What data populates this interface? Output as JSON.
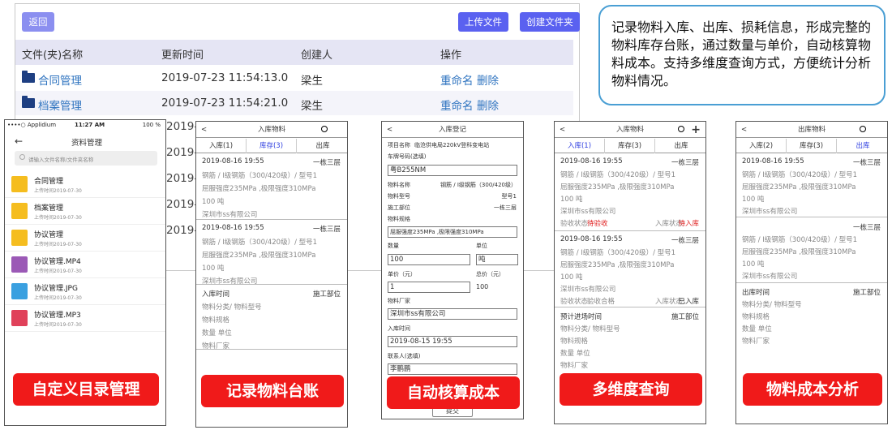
{
  "file_panel": {
    "back": "返回",
    "upload": "上传文件",
    "new_folder": "创建文件夹",
    "headers": [
      "文件(夹)名称",
      "更新时间",
      "创建人",
      "操作"
    ],
    "rows": [
      {
        "name": "合同管理",
        "time": "2019-07-23 11:54:13.0",
        "creator": "梁生",
        "rename": "重命名",
        "delete": "删除"
      },
      {
        "name": "档案管理",
        "time": "2019-07-23 11:54:21.0",
        "creator": "梁生",
        "rename": "重命名",
        "delete": "删除"
      }
    ],
    "partial_dates": [
      "2019-0",
      "2019-0",
      "2019-0",
      "2019-0",
      "2019-0"
    ]
  },
  "info_box": "记录物料入库、出库、损耗信息，形成完整的物料库存台账，通过数量与单价，自动核算物料成本。支持多维度查询方式，方便统计分析物料情况。",
  "phone1": {
    "status_left": "••••○ Applidium",
    "time": "11:27 AM",
    "battery": "100 %",
    "title": "资料管理",
    "back_arrow": "←",
    "search_placeholder": "请输入文件名称/文件夹名称",
    "items": [
      {
        "name": "合同管理",
        "sub": "上传时间2019-07-30",
        "icon": "folder-icon",
        "color": "#f5bd1f"
      },
      {
        "name": "档案管理",
        "sub": "上传时间2019-07-30",
        "icon": "folder-icon",
        "color": "#f5bd1f"
      },
      {
        "name": "协议管理",
        "sub": "上传时间2019-07-30",
        "icon": "folder-icon",
        "color": "#f5bd1f"
      },
      {
        "name": "协议管理.MP4",
        "sub": "上传时间2019-07-30",
        "icon": "video-file-icon",
        "color": "#9b59b6"
      },
      {
        "name": "协议管理.JPG",
        "sub": "上传时间2019-07-30",
        "icon": "image-file-icon",
        "color": "#3aa0e0"
      },
      {
        "name": "协议管理.MP3",
        "sub": "上传时间2019-07-30",
        "icon": "audio-file-icon",
        "color": "#e0415a"
      }
    ],
    "badge": "自定义目录管理"
  },
  "phone2": {
    "back": "<",
    "title": "入库物料",
    "tabs": [
      "入库(1)",
      "库存(3)",
      "出库"
    ],
    "records": [
      {
        "date": "2019-08-16 19:55",
        "loc": "一栋三层",
        "l1": "钢筋 / Ⅰ级钢筋（300/420级）/ 型号1",
        "l2": "屈服强度235MPa ,极限强度310MPa",
        "l3": "100 吨",
        "l4": "深圳市ss有限公司"
      },
      {
        "date": "2019-08-16 19:55",
        "loc": "一栋三层",
        "l1": "钢筋 / Ⅰ级钢筋（300/420级）/ 型号1",
        "l2": "屈服强度235MPa ,极限强度310MPa",
        "l3": "100 吨",
        "l4": "深圳市ss有限公司"
      }
    ],
    "blank": {
      "l0": "入库时间",
      "loc": "施工部位",
      "l1": "物料分类/ 物料型号",
      "l2": "物料规格",
      "l3": "数量 单位",
      "l4": "物料厂家"
    },
    "badge": "记录物料台账"
  },
  "phone3": {
    "back": "<",
    "title": "入库登记",
    "project_label": "项目名称",
    "project_value": "临沧供电局220kV登科变电站",
    "plate_label": "车牌号码(选填)",
    "plate_value": "粤B255NM",
    "name_label": "物料名称",
    "name_value": "钢筋 / Ⅰ级钢筋（300/420级）",
    "model_label": "物料型号",
    "model_value": "型号1",
    "site_label": "施工部位",
    "site_value": "一栋三层",
    "spec_label": "物料规格",
    "spec_value": "屈服强度235MPa ,极限强度310MPa",
    "qty_label": "数量",
    "qty_value": "100",
    "unit_label": "单位",
    "unit_value": "吨",
    "price_label": "单价（元）",
    "price_value": "1",
    "total_label": "总价（元）",
    "total_value": "100",
    "maker_label": "物料厂家",
    "maker_value": "深圳市ss有限公司",
    "time_label": "入库时间",
    "time_value": "2019-08-15 19:55",
    "contact_label": "联系人(选填)",
    "contact_value": "李鹏鹏",
    "submit": "提交",
    "badge": "自动核算成本"
  },
  "phone4": {
    "back": "<",
    "title": "入库物料",
    "tabs": [
      "入库(1)",
      "库存(3)",
      "出库"
    ],
    "records": [
      {
        "date": "2019-08-16 19:55",
        "loc": "一栋三层",
        "l1": "钢筋 / Ⅰ级钢筋（300/420级）/ 型号1",
        "l2": "屈服强度235MPa ,极限强度310MPa",
        "l3": "100 吨",
        "l4": "深圳市ss有限公司",
        "check_label": "验收状态:",
        "check_value": "待验收",
        "in_label": "入库状态:",
        "in_value": "待入库"
      },
      {
        "date": "2019-08-16 19:55",
        "loc": "一栋三层",
        "l1": "钢筋 / Ⅰ级钢筋（300/420级）/ 型号1",
        "l2": "屈服强度235MPa ,极限强度310MPa",
        "l3": "100 吨",
        "l4": "深圳市ss有限公司",
        "check_label": "验收状态:",
        "check_value": "验收合格",
        "in_label": "入库状态:",
        "in_value": "已入库"
      }
    ],
    "blank": {
      "l0": "预计进场时间",
      "loc": "施工部位",
      "l1": "物料分类/ 物料型号",
      "l2": "物料规格",
      "l3": "数量 单位",
      "l4": "物料厂家"
    },
    "badge": "多维度查询"
  },
  "phone5": {
    "back": "<",
    "title": "出库物料",
    "tabs": [
      "入库(2)",
      "库存(3)",
      "出库"
    ],
    "records": [
      {
        "date": "2019-08-16 19:55",
        "loc": "一栋三层",
        "l1": "钢筋 / Ⅰ级钢筋（300/420级）/ 型号1",
        "l2": "屈服强度235MPa ,极限强度310MPa",
        "l3": "100 吨",
        "l4": "深圳市ss有限公司"
      },
      {
        "date": "",
        "loc": "一栋三层",
        "l1": "钢筋 / Ⅰ级钢筋（300/420级）/ 型号1",
        "l2": "屈服强度235MPa ,极限强度310MPa",
        "l3": "100 吨",
        "l4": "深圳市ss有限公司"
      }
    ],
    "blank": {
      "l0": "出库时间",
      "loc": "施工部位",
      "l1": "物料分类/ 物料型号",
      "l2": "物料规格",
      "l3": "数量 单位",
      "l4": "物料厂家"
    },
    "badge": "物料成本分析"
  }
}
